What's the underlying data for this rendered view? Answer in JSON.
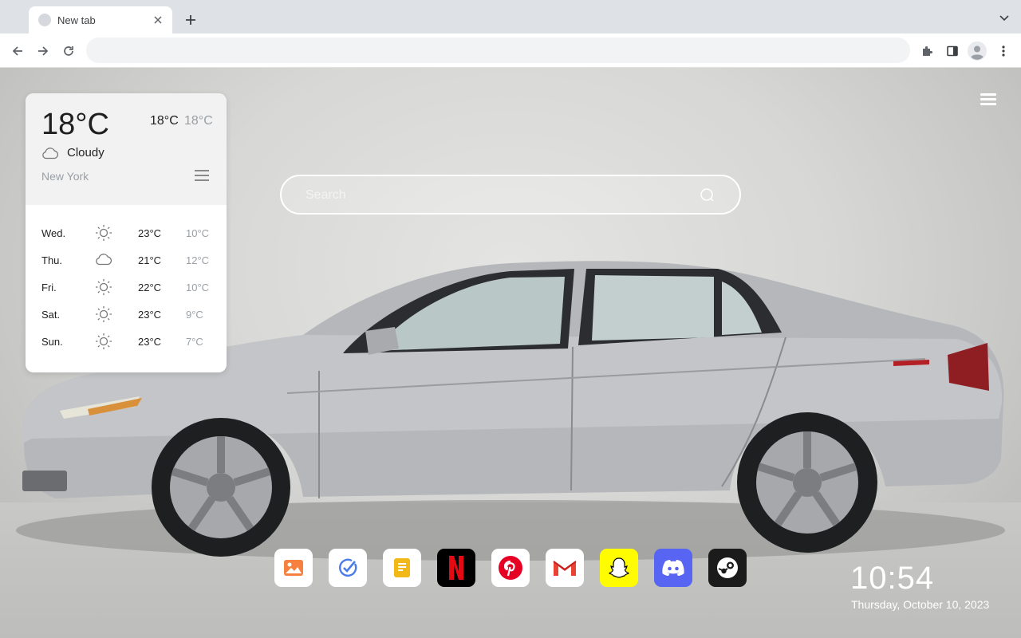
{
  "browser": {
    "tab_title": "New tab",
    "address_value": "",
    "address_placeholder": ""
  },
  "weather": {
    "current_temp": "18°C",
    "high": "18°C",
    "low": "18°C",
    "condition": "Cloudy",
    "condition_icon": "cloud-icon",
    "city": "New York",
    "forecast": [
      {
        "day": "Wed.",
        "icon": "sun-icon",
        "high": "23°C",
        "low": "10°C"
      },
      {
        "day": "Thu.",
        "icon": "cloud-icon",
        "high": "21°C",
        "low": "12°C"
      },
      {
        "day": "Fri.",
        "icon": "sun-icon",
        "high": "22°C",
        "low": "10°C"
      },
      {
        "day": "Sat.",
        "icon": "sun-icon",
        "high": "23°C",
        "low": "9°C"
      },
      {
        "day": "Sun.",
        "icon": "sun-icon",
        "high": "23°C",
        "low": "7°C"
      }
    ]
  },
  "search": {
    "placeholder": "Search"
  },
  "dock": [
    {
      "name": "gallery",
      "icon": "gallery-icon",
      "bg": "#ffffff"
    },
    {
      "name": "tasks",
      "icon": "check-circle-icon",
      "bg": "#ffffff"
    },
    {
      "name": "notes",
      "icon": "notes-icon",
      "bg": "#ffffff"
    },
    {
      "name": "netflix",
      "icon": "netflix-icon",
      "bg": "#000000"
    },
    {
      "name": "pinterest",
      "icon": "pinterest-icon",
      "bg": "#ffffff"
    },
    {
      "name": "gmail",
      "icon": "gmail-icon",
      "bg": "#ffffff"
    },
    {
      "name": "snapchat",
      "icon": "snapchat-icon",
      "bg": "#fffc00"
    },
    {
      "name": "discord",
      "icon": "discord-icon",
      "bg": "#5865f2"
    },
    {
      "name": "steam",
      "icon": "steam-icon",
      "bg": "#1b1b1b"
    }
  ],
  "clock": {
    "time": "10:54",
    "date": "Thursday, October 10, 2023"
  }
}
